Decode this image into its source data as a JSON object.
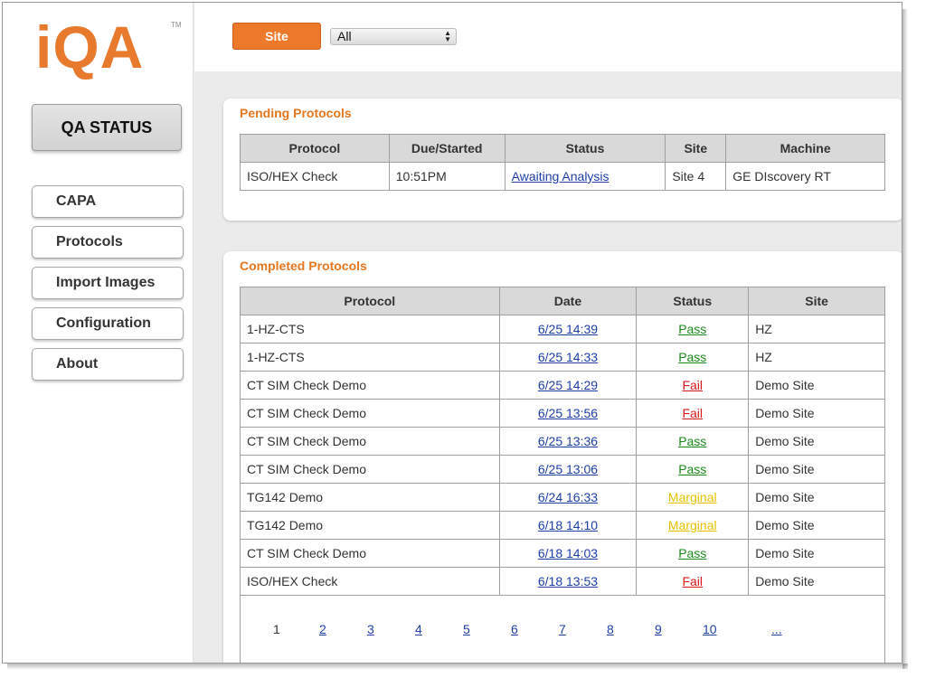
{
  "brand": {
    "logo": "iQA",
    "tm": "TM"
  },
  "sidebar": {
    "active": "QA STATUS",
    "items": [
      {
        "label": "CAPA"
      },
      {
        "label": "Protocols"
      },
      {
        "label": "Import Images"
      },
      {
        "label": "Configuration"
      },
      {
        "label": "About"
      }
    ]
  },
  "topbar": {
    "site_button": "Site",
    "site_filter_value": "All"
  },
  "pending": {
    "title": "Pending Protocols",
    "columns": [
      "Protocol",
      "Due/Started",
      "Status",
      "Site",
      "Machine"
    ],
    "rows": [
      {
        "protocol": "ISO/HEX Check",
        "due": "10:51PM",
        "status": "Awaiting Analysis",
        "site": "Site 4",
        "machine": "GE DIscovery RT"
      }
    ]
  },
  "completed": {
    "title": "Completed Protocols",
    "columns": [
      "Protocol",
      "Date",
      "Status",
      "Site"
    ],
    "rows": [
      {
        "protocol": "1-HZ-CTS",
        "date": "6/25 14:39",
        "status": "Pass",
        "site": "HZ"
      },
      {
        "protocol": "1-HZ-CTS",
        "date": "6/25 14:33",
        "status": "Pass",
        "site": "HZ"
      },
      {
        "protocol": "CT SIM Check Demo",
        "date": "6/25 14:29",
        "status": "Fail",
        "site": "Demo Site"
      },
      {
        "protocol": "CT SIM Check Demo",
        "date": "6/25 13:56",
        "status": "Fail",
        "site": "Demo Site"
      },
      {
        "protocol": "CT SIM Check Demo",
        "date": "6/25 13:36",
        "status": "Pass",
        "site": "Demo Site"
      },
      {
        "protocol": "CT SIM Check Demo",
        "date": "6/25 13:06",
        "status": "Pass",
        "site": "Demo Site"
      },
      {
        "protocol": "TG142 Demo",
        "date": "6/24 16:33",
        "status": "Marginal",
        "site": "Demo Site"
      },
      {
        "protocol": "TG142 Demo",
        "date": "6/18 14:10",
        "status": "Marginal",
        "site": "Demo Site"
      },
      {
        "protocol": "CT SIM Check Demo",
        "date": "6/18 14:03",
        "status": "Pass",
        "site": "Demo Site"
      },
      {
        "protocol": "ISO/HEX Check",
        "date": "6/18 13:53",
        "status": "Fail",
        "site": "Demo Site"
      }
    ],
    "pagination": [
      "1",
      "2",
      "3",
      "4",
      "5",
      "6",
      "7",
      "8",
      "9",
      "10",
      "..."
    ],
    "current_page": "1"
  },
  "colors": {
    "accent": "#ec7a2a",
    "pass": "#1a8a1a",
    "fail": "#d81818",
    "marginal": "#e8c000",
    "link": "#1f3fa8"
  }
}
